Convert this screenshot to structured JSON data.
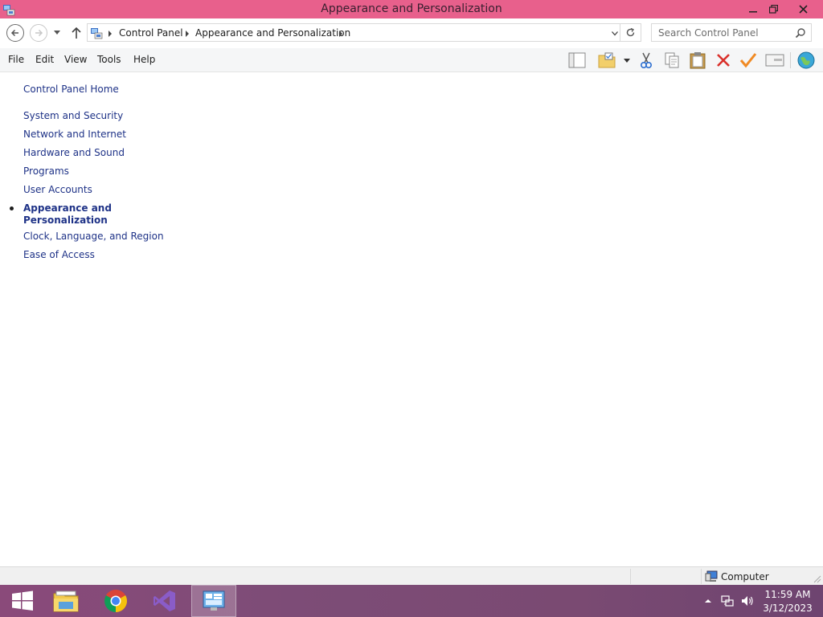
{
  "window": {
    "title": "Appearance and Personalization",
    "controls": {
      "minimize": "minimize",
      "maximize": "restore",
      "close": "close"
    }
  },
  "address": {
    "breadcrumbs": [
      "Control Panel",
      "Appearance and Personalization"
    ],
    "search_placeholder": "Search Control Panel"
  },
  "menu": [
    "File",
    "Edit",
    "View",
    "Tools",
    "Help"
  ],
  "toolbar_icons": [
    "layout-pane-icon",
    "folder-check-icon",
    "cut-icon",
    "copy-icon",
    "paste-icon",
    "delete-icon",
    "check-icon",
    "properties-icon",
    "globe-icon"
  ],
  "leftnav": {
    "home": "Control Panel Home",
    "items": [
      "System and Security",
      "Network and Internet",
      "Hardware and Sound",
      "Programs",
      "User Accounts",
      "Appearance and Personalization",
      "Clock, Language, and Region",
      "Ease of Access"
    ],
    "current": "Appearance and Personalization"
  },
  "statusbar": {
    "location": "Computer"
  },
  "taskbar": {
    "apps": [
      "start",
      "file-explorer",
      "chrome",
      "visual-studio",
      "control-panel"
    ],
    "time": "11:59 AM",
    "date": "3/12/2023"
  },
  "colors": {
    "titlebar": "#e8608c",
    "taskbar": "#7d4c77",
    "link": "#1e3287"
  }
}
